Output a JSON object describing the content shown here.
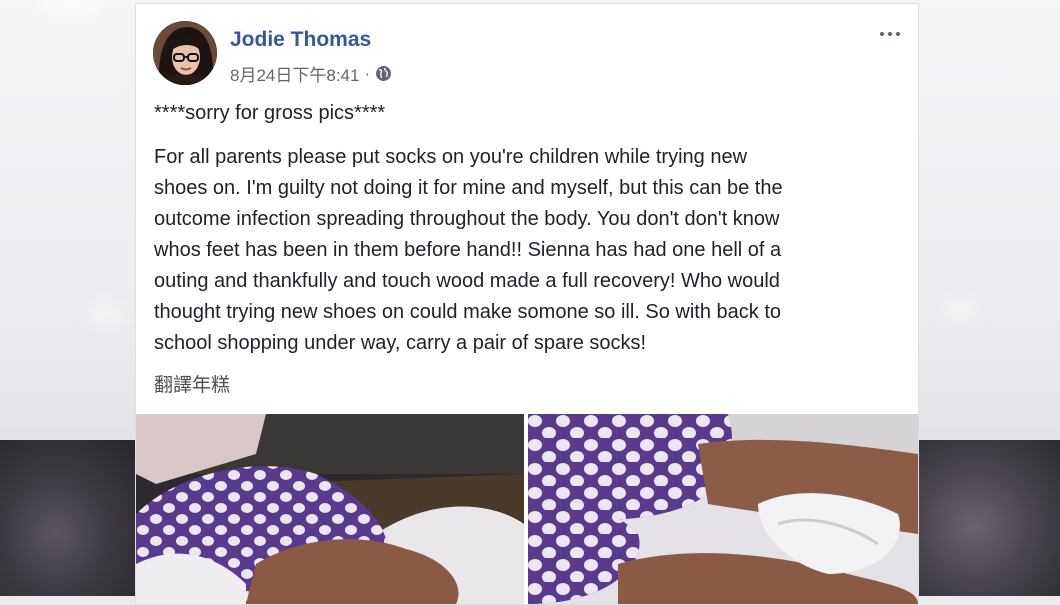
{
  "post": {
    "author": "Jodie Thomas",
    "timestamp": "8月24日下午8:41",
    "separator": "·",
    "privacy_icon": "globe-icon",
    "more_icon": "more-options-icon",
    "line1": "****sorry for gross pics****",
    "body": "For all parents please put socks on you're children while trying new\nshoes on. I'm guilty not doing it for mine and myself, but this can be the\noutcome infection spreading throughout the body. You don't don't know\nwhos feet has been in them before hand!! Sienna has had one hell of a\nouting and thankfully and touch wood made a full recovery! Who would\nthought trying new shoes on could make somone so ill. So with back to\nschool shopping under way, carry a pair of spare socks!",
    "translate_link": "翻譯年糕"
  },
  "colors": {
    "author_link": "#365899",
    "meta_text": "#616770",
    "body_text": "#1d2129",
    "card_bg": "#ffffff",
    "page_bg": "#e9ebee",
    "pajama_purple": "#5a3a8c"
  }
}
